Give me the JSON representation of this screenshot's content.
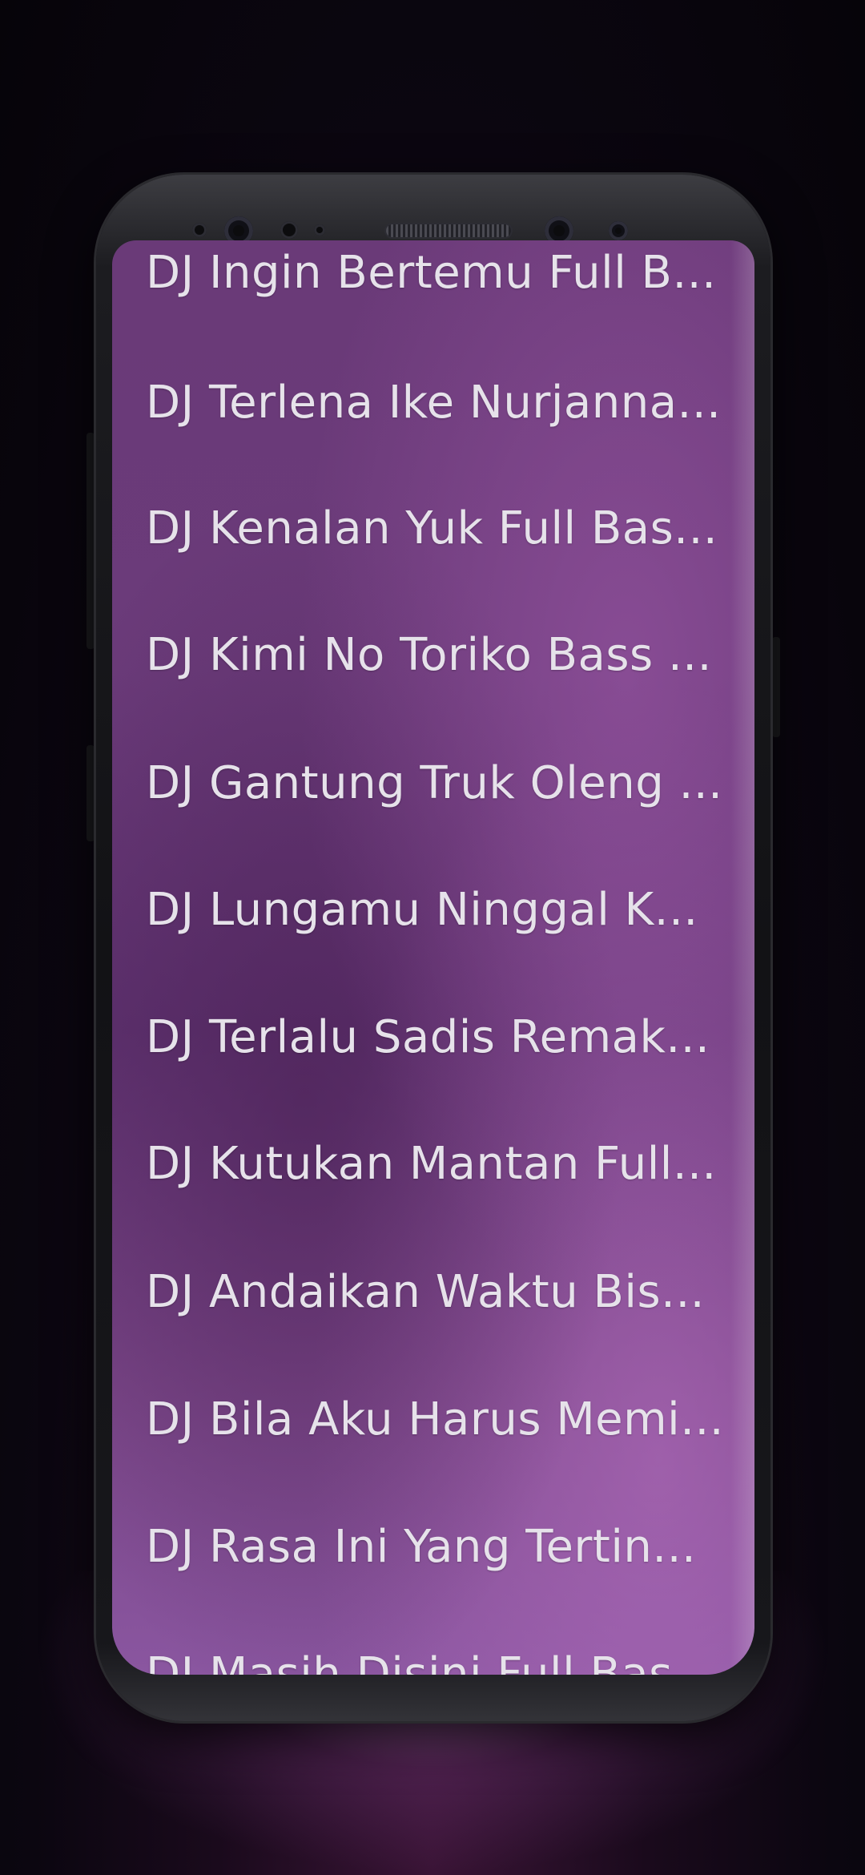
{
  "tracks": [
    {
      "title": "DJ Ingin Bertemu Full B..."
    },
    {
      "title": "DJ Terlena Ike Nurjanna..."
    },
    {
      "title": "DJ Kenalan Yuk Full Bas..."
    },
    {
      "title": "DJ Kimi No Toriko Bass ..."
    },
    {
      "title": "DJ Gantung Truk Oleng ..."
    },
    {
      "title": "DJ Lungamu Ninggal K..."
    },
    {
      "title": "DJ Terlalu Sadis Remak..."
    },
    {
      "title": "DJ Kutukan Mantan Full..."
    },
    {
      "title": "DJ Andaikan Waktu Bis..."
    },
    {
      "title": "DJ Bila Aku Harus Memi..."
    },
    {
      "title": "DJ Rasa Ini Yang Tertin..."
    },
    {
      "title": "DJ Masih Disini Full Bas..."
    }
  ],
  "colors": {
    "screen_background": "#6a3a78",
    "text": "#e6e2ea",
    "phone_frame": "#121215"
  }
}
